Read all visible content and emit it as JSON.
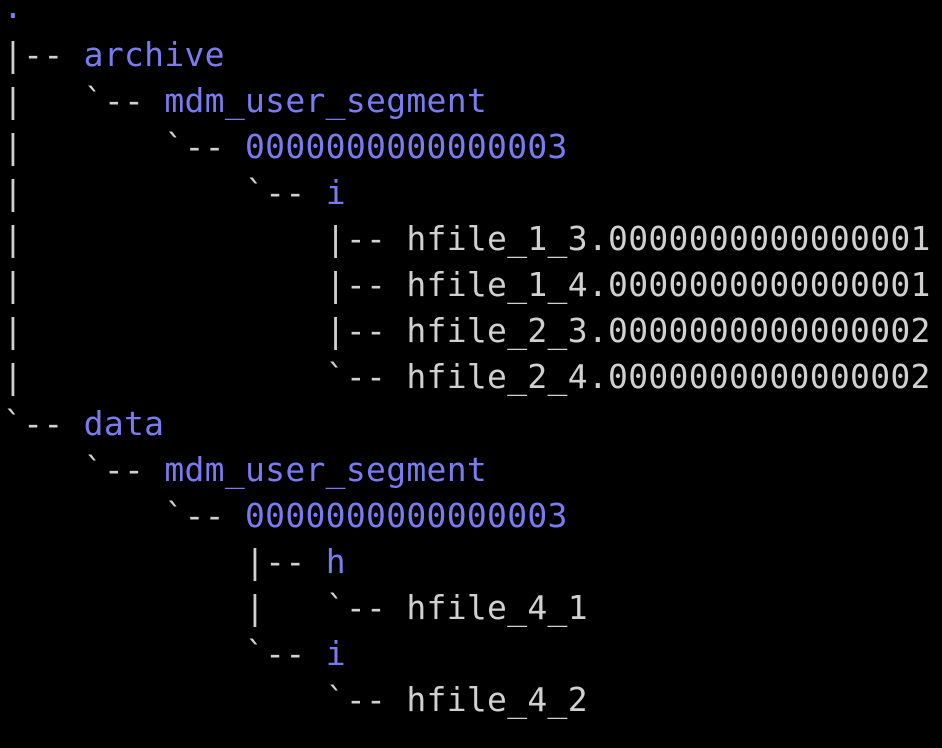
{
  "colors": {
    "background": "#000000",
    "directory": "#7b7bf0",
    "file": "#d0d0d0"
  },
  "tree": {
    "root": ".",
    "lines": [
      {
        "prefix": "|-- ",
        "name": "archive",
        "kind": "dir"
      },
      {
        "prefix": "|   `-- ",
        "name": "mdm_user_segment",
        "kind": "dir"
      },
      {
        "prefix": "|       `-- ",
        "name": "0000000000000003",
        "kind": "dir"
      },
      {
        "prefix": "|           `-- ",
        "name": "i",
        "kind": "dir"
      },
      {
        "prefix": "|               |-- ",
        "name": "hfile_1_3.0000000000000001",
        "kind": "file"
      },
      {
        "prefix": "|               |-- ",
        "name": "hfile_1_4.0000000000000001",
        "kind": "file"
      },
      {
        "prefix": "|               |-- ",
        "name": "hfile_2_3.0000000000000002",
        "kind": "file"
      },
      {
        "prefix": "|               `-- ",
        "name": "hfile_2_4.0000000000000002",
        "kind": "file"
      },
      {
        "prefix": "`-- ",
        "name": "data",
        "kind": "dir"
      },
      {
        "prefix": "    `-- ",
        "name": "mdm_user_segment",
        "kind": "dir"
      },
      {
        "prefix": "        `-- ",
        "name": "0000000000000003",
        "kind": "dir"
      },
      {
        "prefix": "            |-- ",
        "name": "h",
        "kind": "dir"
      },
      {
        "prefix": "            |   `-- ",
        "name": "hfile_4_1",
        "kind": "file"
      },
      {
        "prefix": "            `-- ",
        "name": "i",
        "kind": "dir"
      },
      {
        "prefix": "                `-- ",
        "name": "hfile_4_2",
        "kind": "file"
      }
    ]
  }
}
